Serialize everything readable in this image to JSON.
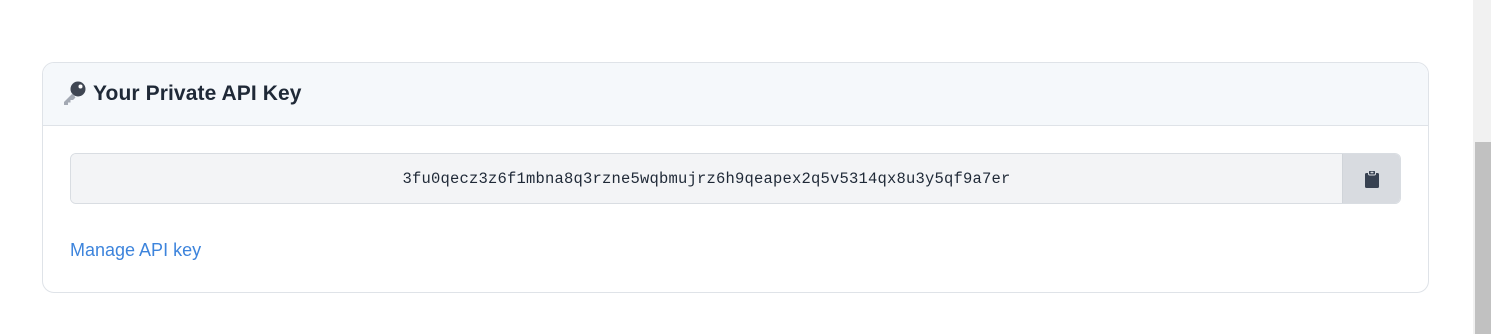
{
  "card": {
    "title": "Your Private API Key",
    "title_icon": "key-icon"
  },
  "api_key": {
    "value": "3fu0qecz3z6f1mbna8q3rzne5wqbmujrz6h9qeapex2q5v5314qx8u3y5qf9a7er",
    "copy_icon": "clipboard-icon"
  },
  "links": {
    "manage_label": "Manage API key"
  },
  "colors": {
    "header_bg": "#f5f8fb",
    "key_bg": "#f3f4f6",
    "copy_bg": "#d8dbe0",
    "link": "#3d84dc",
    "text": "#1f2937"
  }
}
